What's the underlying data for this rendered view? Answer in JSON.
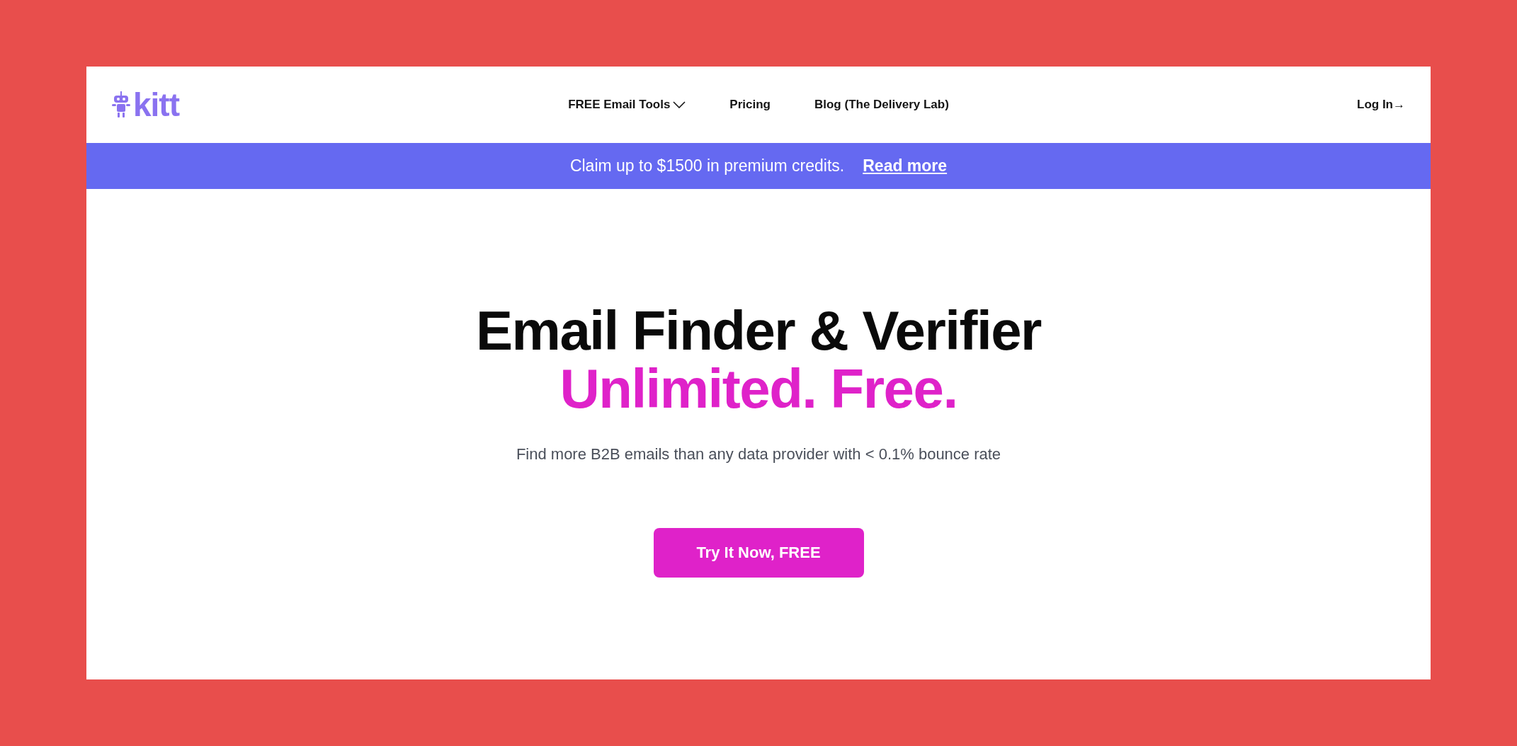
{
  "brand": {
    "name": "kitt"
  },
  "nav": {
    "links": [
      {
        "label": "FREE Email Tools",
        "kind": "dropdown"
      },
      {
        "label": "Pricing",
        "kind": "link"
      },
      {
        "label": "Blog (The Delivery Lab)",
        "kind": "link"
      }
    ],
    "login": "Log In→"
  },
  "banner": {
    "text": "Claim up to $1500 in premium credits.",
    "link": "Read more"
  },
  "hero": {
    "title": "Email Finder & Verifier",
    "highlight": "Unlimited. Free.",
    "subtitle": "Find more B2B emails than any data provider with < 0.1% bounce rate",
    "cta": "Try It Now, FREE"
  }
}
